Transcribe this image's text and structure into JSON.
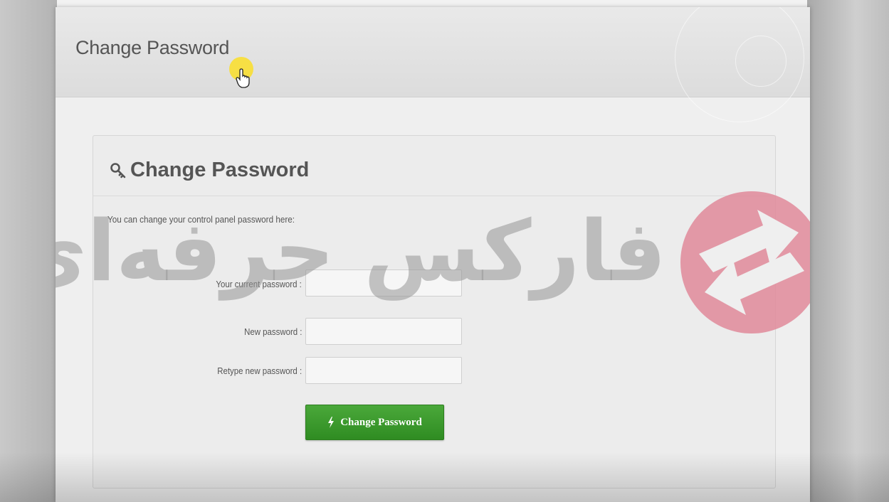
{
  "window": {
    "header_title": "Change Password"
  },
  "panel": {
    "title": "Change Password",
    "description": "You can change your control panel password here:",
    "title_icon": "key-icon"
  },
  "form": {
    "current_password": {
      "label": "Your current password :",
      "value": "",
      "placeholder": ""
    },
    "new_password": {
      "label": "New password :",
      "value": "",
      "placeholder": ""
    },
    "retype_password": {
      "label": "Retype new password :",
      "value": "",
      "placeholder": ""
    },
    "submit": {
      "label": "Change Password",
      "icon": "bolt-icon",
      "color": "#3a9a2c"
    }
  },
  "watermark": {
    "text": "فارکس حرفه‌ای",
    "logo_color": "#e08a9a"
  },
  "cursor": {
    "icon": "hand-pointer-icon",
    "highlight_color": "#f5dc28"
  }
}
